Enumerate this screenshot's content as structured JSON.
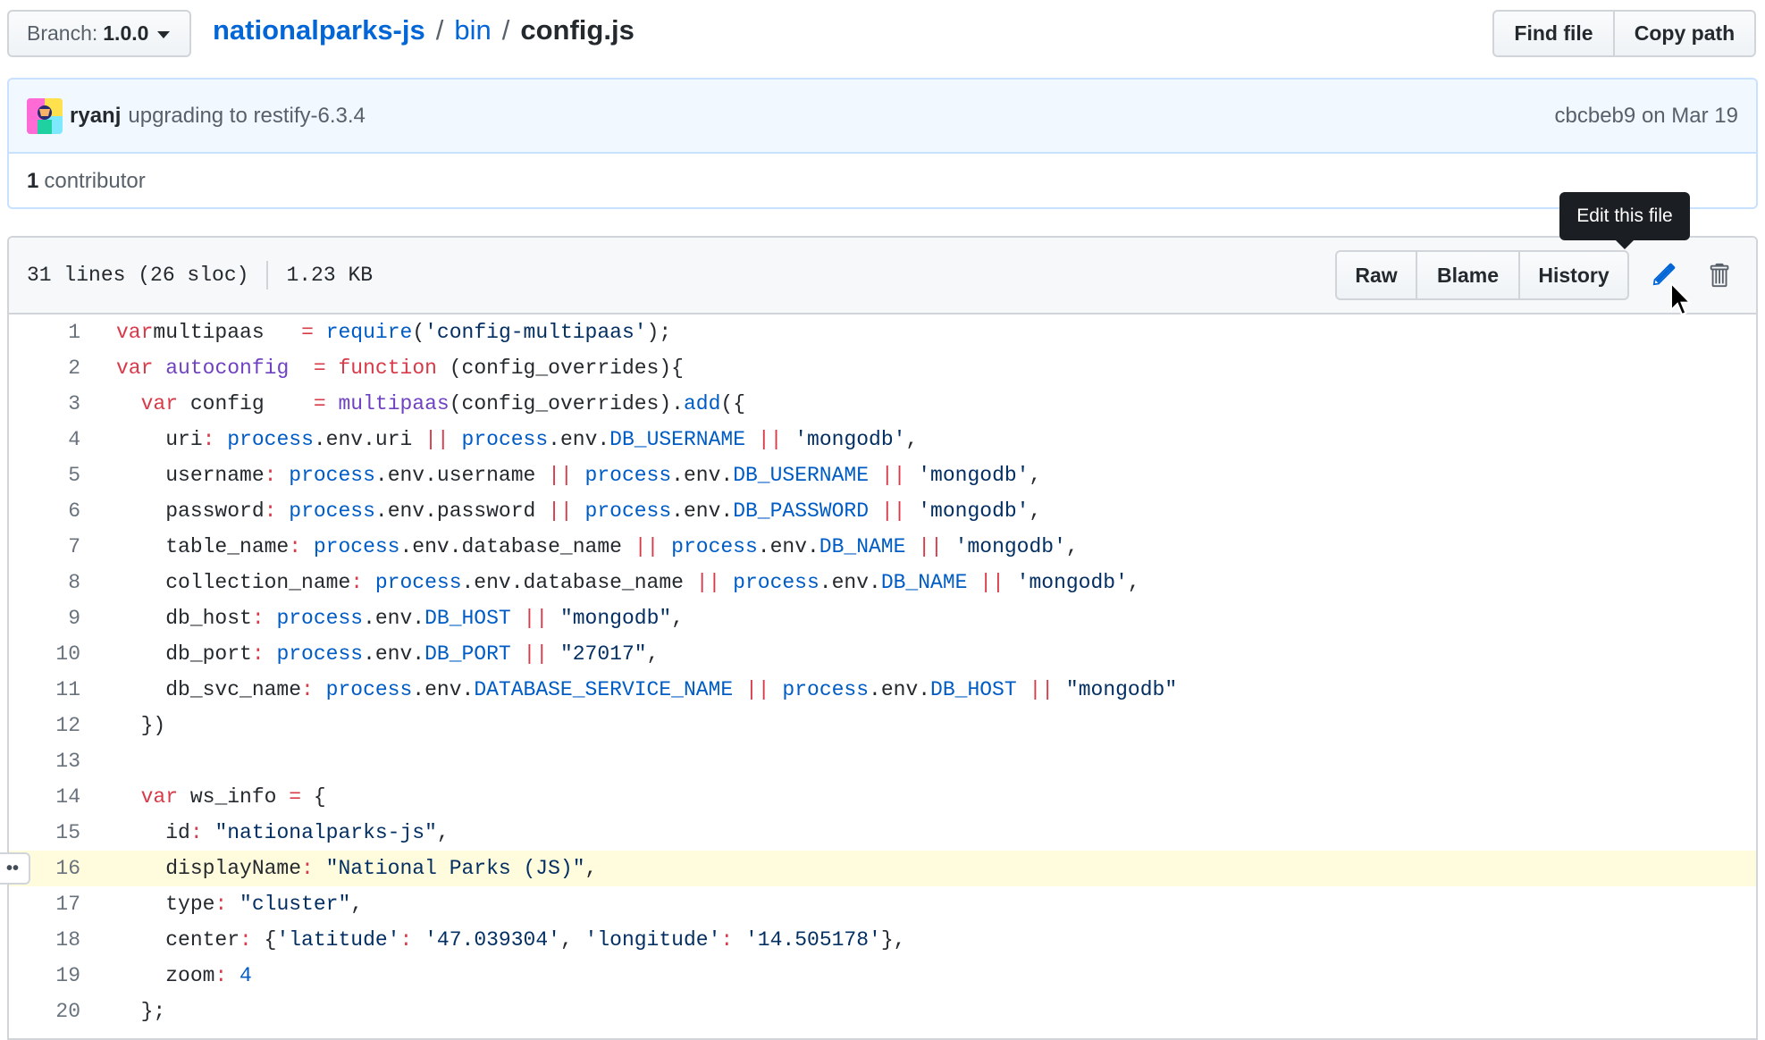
{
  "branch": {
    "prefix": "Branch:",
    "name": "1.0.0"
  },
  "breadcrumb": {
    "root": "nationalparks-js",
    "folder": "bin",
    "file": "config.js",
    "separator": "/"
  },
  "top_actions": {
    "find_file": "Find file",
    "copy_path": "Copy path"
  },
  "commit": {
    "author": "ryanj",
    "message": "upgrading to restify-6.3.4",
    "sha": "cbcbeb9",
    "date_text": "on Mar 19",
    "contributors_count": "1",
    "contributors_label": "contributor"
  },
  "file_info": {
    "lines": "31 lines (26 sloc)",
    "size": "1.23 KB"
  },
  "file_actions": {
    "raw": "Raw",
    "blame": "Blame",
    "history": "History"
  },
  "tooltip": "Edit this file",
  "icons": {
    "edit": "pencil-icon",
    "delete": "trash-icon",
    "caret": "caret-down-icon",
    "cursor": "mouse-pointer-icon",
    "ellipsis": "ellipsis-icon"
  },
  "colors": {
    "link": "#0366d6",
    "keyword": "#d73a49",
    "function": "#6f42c1",
    "constant": "#005cc5",
    "string": "#032f62",
    "highlight": "#fffbdd"
  },
  "highlighted_line": 16,
  "code_lines": [
    {
      "n": "1",
      "t": [
        [
          "kw",
          "var"
        ],
        [
          "",
          "multipaas   "
        ],
        [
          "kw",
          "="
        ],
        [
          "",
          " "
        ],
        [
          "c1",
          "require"
        ],
        [
          "",
          "("
        ],
        [
          "st",
          "'config-multipaas'"
        ],
        [
          "",
          ");"
        ]
      ]
    },
    {
      "n": "2",
      "t": [
        [
          "kw",
          "var"
        ],
        [
          "",
          " "
        ],
        [
          "fn",
          "autoconfig"
        ],
        [
          "",
          "  "
        ],
        [
          "kw",
          "="
        ],
        [
          "",
          " "
        ],
        [
          "kw",
          "function"
        ],
        [
          "",
          " (config_overrides){"
        ]
      ]
    },
    {
      "n": "3",
      "t": [
        [
          "",
          "  "
        ],
        [
          "kw",
          "var"
        ],
        [
          "",
          " config    "
        ],
        [
          "kw",
          "="
        ],
        [
          "",
          " "
        ],
        [
          "fn",
          "multipaas"
        ],
        [
          "",
          "(config_overrides)."
        ],
        [
          "c1",
          "add"
        ],
        [
          "",
          "({"
        ]
      ]
    },
    {
      "n": "4",
      "t": [
        [
          "",
          "    uri"
        ],
        [
          "kw",
          ":"
        ],
        [
          "",
          " "
        ],
        [
          "c1",
          "process"
        ],
        [
          "",
          ".env.uri "
        ],
        [
          "kw",
          "||"
        ],
        [
          "",
          " "
        ],
        [
          "c1",
          "process"
        ],
        [
          "",
          ".env."
        ],
        [
          "c1",
          "DB_USERNAME"
        ],
        [
          "",
          " "
        ],
        [
          "kw",
          "||"
        ],
        [
          "",
          " "
        ],
        [
          "st",
          "'mongodb'"
        ],
        [
          "",
          ","
        ]
      ]
    },
    {
      "n": "5",
      "t": [
        [
          "",
          "    username"
        ],
        [
          "kw",
          ":"
        ],
        [
          "",
          " "
        ],
        [
          "c1",
          "process"
        ],
        [
          "",
          ".env.username "
        ],
        [
          "kw",
          "||"
        ],
        [
          "",
          " "
        ],
        [
          "c1",
          "process"
        ],
        [
          "",
          ".env."
        ],
        [
          "c1",
          "DB_USERNAME"
        ],
        [
          "",
          " "
        ],
        [
          "kw",
          "||"
        ],
        [
          "",
          " "
        ],
        [
          "st",
          "'mongodb'"
        ],
        [
          "",
          ","
        ]
      ]
    },
    {
      "n": "6",
      "t": [
        [
          "",
          "    password"
        ],
        [
          "kw",
          ":"
        ],
        [
          "",
          " "
        ],
        [
          "c1",
          "process"
        ],
        [
          "",
          ".env.password "
        ],
        [
          "kw",
          "||"
        ],
        [
          "",
          " "
        ],
        [
          "c1",
          "process"
        ],
        [
          "",
          ".env."
        ],
        [
          "c1",
          "DB_PASSWORD"
        ],
        [
          "",
          " "
        ],
        [
          "kw",
          "||"
        ],
        [
          "",
          " "
        ],
        [
          "st",
          "'mongodb'"
        ],
        [
          "",
          ","
        ]
      ]
    },
    {
      "n": "7",
      "t": [
        [
          "",
          "    table_name"
        ],
        [
          "kw",
          ":"
        ],
        [
          "",
          " "
        ],
        [
          "c1",
          "process"
        ],
        [
          "",
          ".env.database_name "
        ],
        [
          "kw",
          "||"
        ],
        [
          "",
          " "
        ],
        [
          "c1",
          "process"
        ],
        [
          "",
          ".env."
        ],
        [
          "c1",
          "DB_NAME"
        ],
        [
          "",
          " "
        ],
        [
          "kw",
          "||"
        ],
        [
          "",
          " "
        ],
        [
          "st",
          "'mongodb'"
        ],
        [
          "",
          ","
        ]
      ]
    },
    {
      "n": "8",
      "t": [
        [
          "",
          "    collection_name"
        ],
        [
          "kw",
          ":"
        ],
        [
          "",
          " "
        ],
        [
          "c1",
          "process"
        ],
        [
          "",
          ".env.database_name "
        ],
        [
          "kw",
          "||"
        ],
        [
          "",
          " "
        ],
        [
          "c1",
          "process"
        ],
        [
          "",
          ".env."
        ],
        [
          "c1",
          "DB_NAME"
        ],
        [
          "",
          " "
        ],
        [
          "kw",
          "||"
        ],
        [
          "",
          " "
        ],
        [
          "st",
          "'mongodb'"
        ],
        [
          "",
          ","
        ]
      ]
    },
    {
      "n": "9",
      "t": [
        [
          "",
          "    db_host"
        ],
        [
          "kw",
          ":"
        ],
        [
          "",
          " "
        ],
        [
          "c1",
          "process"
        ],
        [
          "",
          ".env."
        ],
        [
          "c1",
          "DB_HOST"
        ],
        [
          "",
          " "
        ],
        [
          "kw",
          "||"
        ],
        [
          "",
          " "
        ],
        [
          "st",
          "\"mongodb\""
        ],
        [
          "",
          ","
        ]
      ]
    },
    {
      "n": "10",
      "t": [
        [
          "",
          "    db_port"
        ],
        [
          "kw",
          ":"
        ],
        [
          "",
          " "
        ],
        [
          "c1",
          "process"
        ],
        [
          "",
          ".env."
        ],
        [
          "c1",
          "DB_PORT"
        ],
        [
          "",
          " "
        ],
        [
          "kw",
          "||"
        ],
        [
          "",
          " "
        ],
        [
          "st",
          "\"27017\""
        ],
        [
          "",
          ","
        ]
      ]
    },
    {
      "n": "11",
      "t": [
        [
          "",
          "    db_svc_name"
        ],
        [
          "kw",
          ":"
        ],
        [
          "",
          " "
        ],
        [
          "c1",
          "process"
        ],
        [
          "",
          ".env."
        ],
        [
          "c1",
          "DATABASE_SERVICE_NAME"
        ],
        [
          "",
          " "
        ],
        [
          "kw",
          "||"
        ],
        [
          "",
          " "
        ],
        [
          "c1",
          "process"
        ],
        [
          "",
          ".env."
        ],
        [
          "c1",
          "DB_HOST"
        ],
        [
          "",
          " "
        ],
        [
          "kw",
          "||"
        ],
        [
          "",
          " "
        ],
        [
          "st",
          "\"mongodb\""
        ]
      ]
    },
    {
      "n": "12",
      "t": [
        [
          "",
          "  })"
        ]
      ]
    },
    {
      "n": "13",
      "t": [
        [
          "",
          ""
        ]
      ]
    },
    {
      "n": "14",
      "t": [
        [
          "",
          "  "
        ],
        [
          "kw",
          "var"
        ],
        [
          "",
          " ws_info "
        ],
        [
          "kw",
          "="
        ],
        [
          "",
          " {"
        ]
      ]
    },
    {
      "n": "15",
      "t": [
        [
          "",
          "    id"
        ],
        [
          "kw",
          ":"
        ],
        [
          "",
          " "
        ],
        [
          "st",
          "\"nationalparks-js\""
        ],
        [
          "",
          ","
        ]
      ]
    },
    {
      "n": "16",
      "t": [
        [
          "",
          "    displayName"
        ],
        [
          "kw",
          ":"
        ],
        [
          "",
          " "
        ],
        [
          "st",
          "\"National Parks (JS)\""
        ],
        [
          "",
          ","
        ]
      ]
    },
    {
      "n": "17",
      "t": [
        [
          "",
          "    type"
        ],
        [
          "kw",
          ":"
        ],
        [
          "",
          " "
        ],
        [
          "st",
          "\"cluster\""
        ],
        [
          "",
          ","
        ]
      ]
    },
    {
      "n": "18",
      "t": [
        [
          "",
          "    center"
        ],
        [
          "kw",
          ":"
        ],
        [
          "",
          " {"
        ],
        [
          "st",
          "'latitude'"
        ],
        [
          "kw",
          ":"
        ],
        [
          "",
          " "
        ],
        [
          "st",
          "'47.039304'"
        ],
        [
          "",
          ", "
        ],
        [
          "st",
          "'longitude'"
        ],
        [
          "kw",
          ":"
        ],
        [
          "",
          " "
        ],
        [
          "st",
          "'14.505178'"
        ],
        [
          "",
          "},"
        ]
      ]
    },
    {
      "n": "19",
      "t": [
        [
          "",
          "    zoom"
        ],
        [
          "kw",
          ":"
        ],
        [
          "",
          " "
        ],
        [
          "c1",
          "4"
        ]
      ]
    },
    {
      "n": "20",
      "t": [
        [
          "",
          "  };"
        ]
      ]
    }
  ]
}
